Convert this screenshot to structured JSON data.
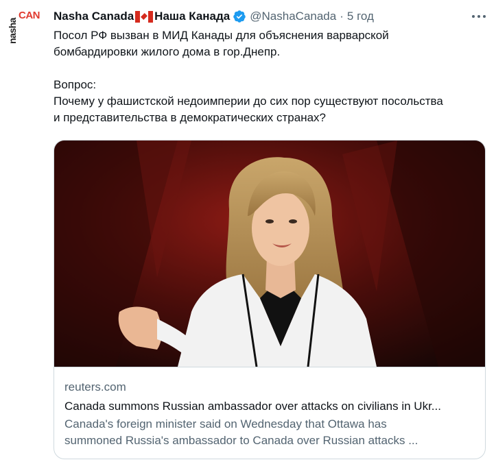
{
  "author": {
    "avatar_text_top": "nasha",
    "avatar_text_main": "CANADA",
    "display_name_en": "Nasha Canada",
    "display_name_ru": "Наша Канада",
    "flag_icon": "canada-flag-icon",
    "verified_icon": "verified-badge-icon",
    "handle": "@NashaCanada",
    "separator": "·",
    "time": "5 год"
  },
  "tweet": {
    "line1": "Посол РФ вызван в МИД Канады для объяснения варварской",
    "line2": "бомбардировки жилого дома в гор.Днепр.",
    "line3": "Вопрос:",
    "line4": "Почему у фашистской недоимперии до сих пор существуют посольства",
    "line5": "и представительства в демократических странах?"
  },
  "card": {
    "domain": "reuters.com",
    "title": "Canada summons Russian ambassador over attacks on civilians in Ukr...",
    "desc_line1": "Canada's foreign minister said on Wednesday that Ottawa has",
    "desc_line2": "summoned Russia's ambassador to Canada over Russian attacks ..."
  },
  "colors": {
    "text": "#0f1419",
    "secondary": "#536471",
    "verified": "#1d9bf0",
    "border": "#cfd9de",
    "brand_red": "#e03a2f"
  }
}
